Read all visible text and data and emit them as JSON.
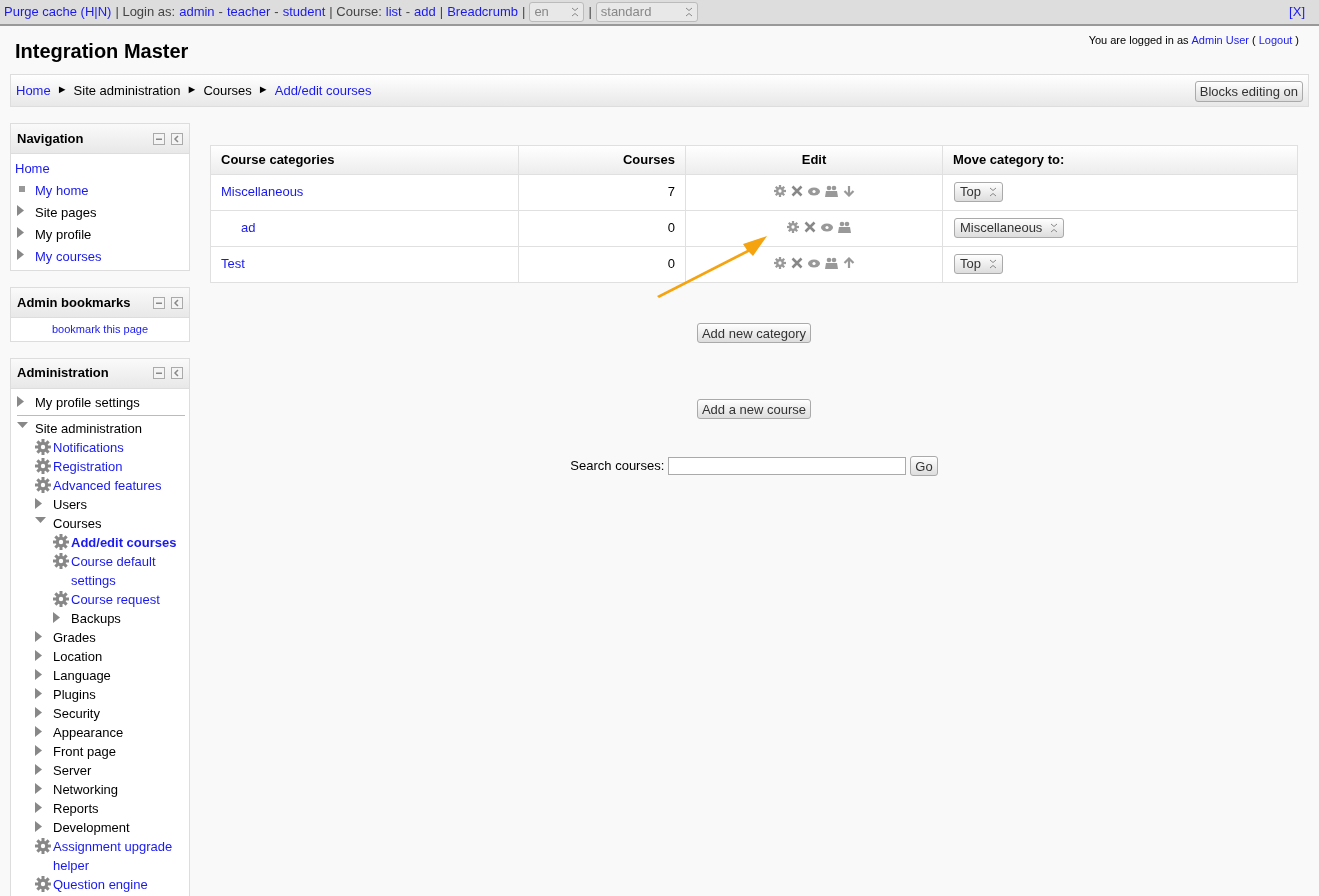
{
  "top_bar": {
    "items": [
      {
        "kind": "link",
        "text": "Purge cache (H|N)"
      },
      {
        "kind": "text",
        "text": "| Login as:"
      },
      {
        "kind": "link",
        "text": "admin"
      },
      {
        "kind": "text",
        "text": "-"
      },
      {
        "kind": "link",
        "text": "teacher"
      },
      {
        "kind": "text",
        "text": "-"
      },
      {
        "kind": "link",
        "text": "student"
      },
      {
        "kind": "text",
        "text": "| Course:"
      },
      {
        "kind": "link",
        "text": "list"
      },
      {
        "kind": "text",
        "text": "-"
      },
      {
        "kind": "link",
        "text": "add"
      },
      {
        "kind": "text",
        "text": "|"
      },
      {
        "kind": "link",
        "text": "Breadcrumb"
      },
      {
        "kind": "text",
        "text": "|"
      },
      {
        "kind": "select",
        "text": "en"
      },
      {
        "kind": "text",
        "text": "|"
      },
      {
        "kind": "select",
        "text": "standard"
      }
    ],
    "close": "[X]"
  },
  "header": {
    "title": "Integration Master",
    "login_info": [
      {
        "kind": "text",
        "text": "You are logged in as"
      },
      {
        "kind": "link",
        "text": "Admin User"
      },
      {
        "kind": "text",
        "text": "("
      },
      {
        "kind": "link",
        "text": "Logout"
      },
      {
        "kind": "text",
        "text": ")"
      }
    ]
  },
  "breadcrumb": {
    "items": [
      {
        "kind": "link",
        "text": "Home"
      },
      {
        "kind": "sep",
        "text": "►"
      },
      {
        "kind": "text",
        "text": "Site administration"
      },
      {
        "kind": "sep",
        "text": "►"
      },
      {
        "kind": "text",
        "text": "Courses"
      },
      {
        "kind": "sep",
        "text": "►"
      },
      {
        "kind": "link",
        "text": "Add/edit courses"
      }
    ],
    "button": "Blocks editing on"
  },
  "blocks": [
    {
      "title": "Navigation",
      "kind": "tree",
      "items": [
        {
          "label": "Home",
          "kind": "plain_link",
          "selected": false
        },
        {
          "label": "My home",
          "kind": "bullet_link",
          "selected": false
        },
        {
          "label": "Site pages",
          "kind": "branch",
          "expanded": false,
          "selected": false
        },
        {
          "label": "My profile",
          "kind": "branch",
          "expanded": false,
          "selected": false
        },
        {
          "label": "My courses",
          "kind": "branch_link",
          "expanded": false,
          "selected": false
        }
      ]
    },
    {
      "title": "Admin bookmarks",
      "kind": "link",
      "link": "bookmark this page"
    },
    {
      "title": "Administration",
      "kind": "tree",
      "items": [
        {
          "label": "My profile settings",
          "kind": "branch",
          "expanded": false,
          "selected": false
        },
        {
          "kind": "divider"
        },
        {
          "label": "Site administration",
          "kind": "branch",
          "expanded": true,
          "selected": false,
          "children": [
            {
              "label": "Notifications",
              "kind": "setting",
              "selected": false
            },
            {
              "label": "Registration",
              "kind": "setting",
              "selected": false
            },
            {
              "label": "Advanced features",
              "kind": "setting",
              "selected": false
            },
            {
              "label": "Users",
              "kind": "branch",
              "expanded": false,
              "selected": false
            },
            {
              "label": "Courses",
              "kind": "branch",
              "expanded": true,
              "selected": false,
              "children": [
                {
                  "label": "Add/edit courses",
                  "kind": "setting",
                  "selected": true
                },
                {
                  "label": "Course default settings",
                  "kind": "setting",
                  "selected": false
                },
                {
                  "label": "Course request",
                  "kind": "setting",
                  "selected": false
                },
                {
                  "label": "Backups",
                  "kind": "branch",
                  "expanded": false,
                  "selected": false
                }
              ]
            },
            {
              "label": "Grades",
              "kind": "branch",
              "expanded": false,
              "selected": false
            },
            {
              "label": "Location",
              "kind": "branch",
              "expanded": false,
              "selected": false
            },
            {
              "label": "Language",
              "kind": "branch",
              "expanded": false,
              "selected": false
            },
            {
              "label": "Plugins",
              "kind": "branch",
              "expanded": false,
              "selected": false
            },
            {
              "label": "Security",
              "kind": "branch",
              "expanded": false,
              "selected": false
            },
            {
              "label": "Appearance",
              "kind": "branch",
              "expanded": false,
              "selected": false
            },
            {
              "label": "Front page",
              "kind": "branch",
              "expanded": false,
              "selected": false
            },
            {
              "label": "Server",
              "kind": "branch",
              "expanded": false,
              "selected": false
            },
            {
              "label": "Networking",
              "kind": "branch",
              "expanded": false,
              "selected": false
            },
            {
              "label": "Reports",
              "kind": "branch",
              "expanded": false,
              "selected": false
            },
            {
              "label": "Development",
              "kind": "branch",
              "expanded": false,
              "selected": false
            },
            {
              "label": "Assignment upgrade helper",
              "kind": "setting",
              "selected": false
            },
            {
              "label": "Question engine",
              "kind": "setting",
              "selected": false
            }
          ]
        }
      ]
    }
  ],
  "table": {
    "columns": [
      "Course categories",
      "Courses",
      "Edit",
      "Move category to:"
    ],
    "rows": [
      {
        "name": "Miscellaneous",
        "courses": "7",
        "move_up": false,
        "move_down": true,
        "move_to": "Top",
        "children": [
          {
            "name": "ad",
            "courses": "0",
            "move_up": false,
            "move_down": false,
            "move_to": "Miscellaneous"
          }
        ]
      },
      {
        "name": "Test",
        "courses": "0",
        "move_up": true,
        "move_down": false,
        "move_to": "Top"
      }
    ]
  },
  "buttons": [
    "Add new category",
    "Add a new course"
  ],
  "search": {
    "label": "Search courses:",
    "button": "Go"
  }
}
